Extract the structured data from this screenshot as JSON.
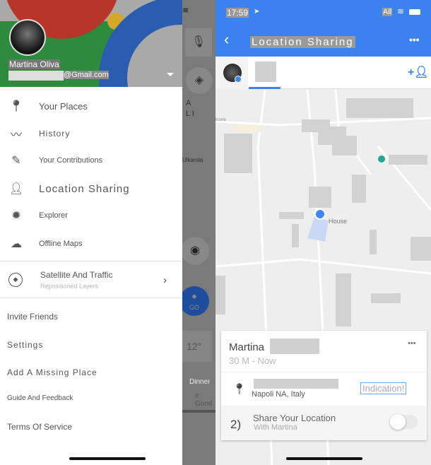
{
  "drawer": {
    "user_name": "Martina Oliva",
    "email_suffix": "@Gmail.com",
    "menu": [
      {
        "icon": "pin-icon",
        "label": "Your Places"
      },
      {
        "icon": "history-icon",
        "label": "History"
      },
      {
        "icon": "contributions-icon",
        "label": "Your Contributions"
      },
      {
        "icon": "location-sharing-icon",
        "label": "Location Sharing"
      },
      {
        "icon": "explore-icon",
        "label": "Explorer"
      },
      {
        "icon": "offline-cloud-icon",
        "label": "Offline Maps"
      }
    ],
    "layers": {
      "title": "Satellite And Traffic",
      "subtitle": "Repositioned Layers"
    },
    "links": [
      "Invite Friends",
      "Settings",
      "Add A Missing Place",
      "Guide And Feedback",
      "Terms Of Service"
    ]
  },
  "background_map": {
    "area_label_1": "A",
    "area_label_2": "L I",
    "place": "Ulkanda",
    "temperature": "12°",
    "card_title": "Dinner",
    "card_sub": "# Good",
    "go_label": "GO"
  },
  "status_bar": {
    "time": "17:59",
    "carrier": "All"
  },
  "header": {
    "title": "Location Sharing"
  },
  "map": {
    "place_label": "House",
    "road_label": "Icone"
  },
  "card": {
    "name": "Martina",
    "duration": "30 M - Now",
    "address": "Napoli NA, Italy",
    "directions_label": "Indication!",
    "share_title": "Share Your Location",
    "share_subtitle": "With Martina",
    "share_prefix": "2)",
    "share_toggle_on": false
  },
  "colors": {
    "accent": "#4285f4",
    "header_blue": "#3b82f0"
  }
}
